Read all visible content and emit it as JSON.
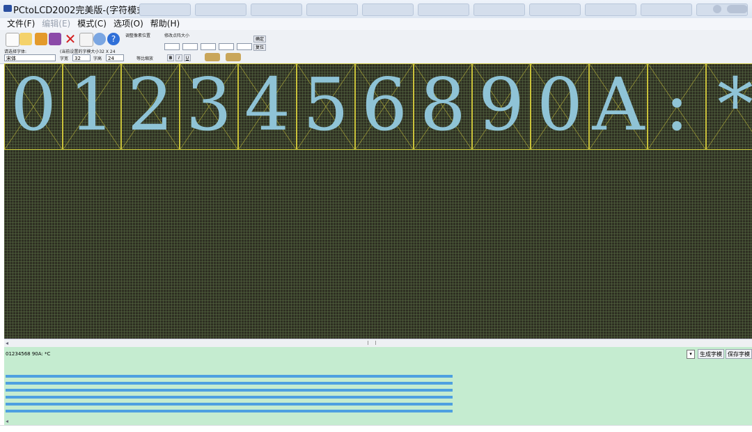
{
  "window": {
    "title": "PCtoLCD2002完美版-(字符模式)"
  },
  "browser_tabs": [
    "",
    "",
    "",
    "",
    "",
    "",
    "",
    "",
    "",
    "",
    "",
    "",
    ""
  ],
  "menu": [
    {
      "label": "文件(F)",
      "enabled": true
    },
    {
      "label": "编辑(E)",
      "enabled": false
    },
    {
      "label": "模式(C)",
      "enabled": true
    },
    {
      "label": "选项(O)",
      "enabled": true
    },
    {
      "label": "帮助(H)",
      "enabled": true
    }
  ],
  "toolbar": {
    "icons": [
      "new-icon",
      "open-icon",
      "save-icon",
      "books-icon",
      "delete-icon",
      "page-icon",
      "settings-icon",
      "help-icon"
    ],
    "font_label": "请选择字体:",
    "font_value": "宋体",
    "size_info": "(当前设置的字模大小32 X 24",
    "width_label": "字宽",
    "width_value": "32",
    "height_label": "字高",
    "height_value": "24",
    "ratio_label": "等比缩放",
    "bold": "B",
    "italic": "I",
    "underline": "U",
    "adjust_label": "调整像素位置",
    "modify_label": "修改点阵大小",
    "ok_label": "确定",
    "reset_label": "复位"
  },
  "lcd": {
    "characters": [
      "0",
      "1",
      "2",
      "3",
      "4",
      "5",
      "6",
      "8",
      "9",
      "0",
      "A",
      ":",
      "*"
    ],
    "accent_color": "#c9c23a",
    "pixel_color": "#8fc3d6",
    "background_color": "#2e2f22"
  },
  "output": {
    "input_text": "01234568 90A: *C",
    "generate_label": "生成字模",
    "save_label": "保存字模",
    "background_color": "#c5ecd0"
  }
}
